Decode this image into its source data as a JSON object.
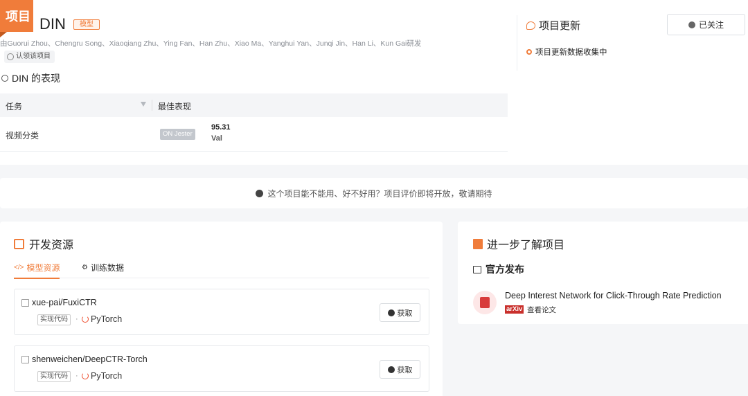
{
  "project": {
    "badge": "项目",
    "name": "DIN",
    "type_tag": "模型",
    "authors": "由Guorui Zhou、Chengru Song、Xiaoqiang Zhu、Ying Fan、Han Zhu、Xiao Ma、Yanghui Yan、Junqi Jin、Han Li、Kun Gai研发",
    "claim_label": "认领该项目"
  },
  "performance": {
    "title": "DIN 的表现",
    "columns": [
      "任务",
      "最佳表现"
    ],
    "rows": [
      {
        "task": "视频分类",
        "dataset": "ON Jester",
        "score": "95.31",
        "metric": "Val"
      }
    ]
  },
  "updates": {
    "title": "项目更新",
    "follow_label": "已关注",
    "item": "项目更新数据收集中"
  },
  "notice": "这个项目能不能用、好不好用？项目评价即将开放，敬请期待",
  "dev_resources": {
    "title": "开发资源",
    "tabs": [
      "模型资源",
      "训练数据"
    ],
    "repos": [
      {
        "name": "xue-pai/FuxiCTR",
        "tag": "实现代码",
        "framework": "PyTorch",
        "action": "获取"
      },
      {
        "name": "shenweichen/DeepCTR-Torch",
        "tag": "实现代码",
        "framework": "PyTorch",
        "action": "获取"
      }
    ]
  },
  "learn_more": {
    "title": "进一步了解项目",
    "section": "官方发布",
    "paper_title": "Deep Interest Network for Click-Through Rate Prediction",
    "source": "arXiv",
    "view_label": "查看论文"
  },
  "colors": {
    "accent": "#f07c3a",
    "arxiv": "#c9302c"
  }
}
